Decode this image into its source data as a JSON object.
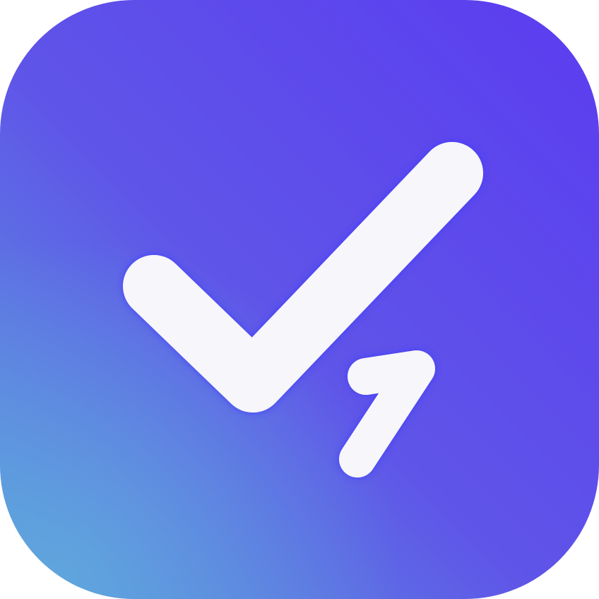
{
  "app_icon": {
    "icon": "checkmark-with-number-one-icon",
    "colors": {
      "gradient_top_right": "#5b3cf0",
      "gradient_mid": "#5f55e8",
      "gradient_bottom_left": "#5a9fdc",
      "glyph": "#f7f6fa",
      "glyph_glow": "#3b3bff"
    }
  }
}
